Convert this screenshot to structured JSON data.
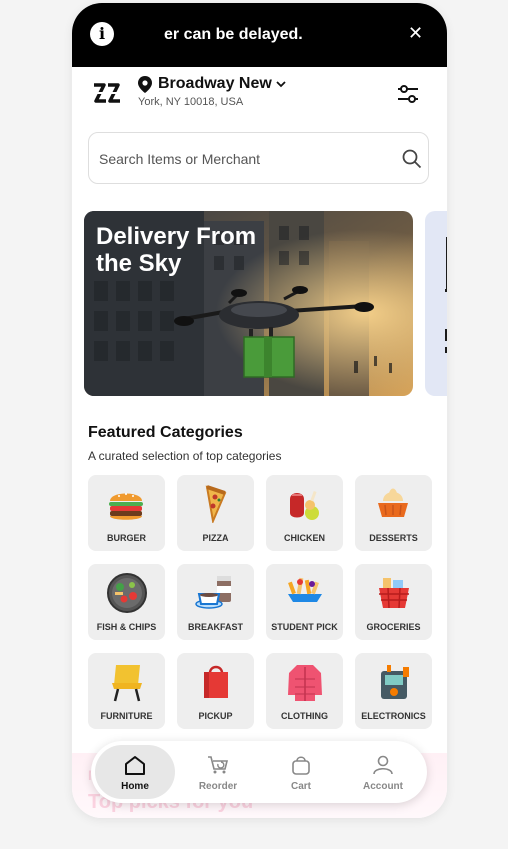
{
  "alert": {
    "text": "er can be delayed.",
    "info_icon": "info-icon",
    "close_icon": "close-icon"
  },
  "header": {
    "address_title": "Broadway New",
    "address_sub": "York, NY 10018, USA"
  },
  "search": {
    "placeholder": "Search Items or Merchant"
  },
  "banner": {
    "title": "Delivery From the Sky"
  },
  "featured": {
    "title": "Featured Categories",
    "subtitle": "A curated selection of top categories",
    "categories": [
      {
        "label": "BURGER",
        "icon": "burger-icon"
      },
      {
        "label": "PIZZA",
        "icon": "pizza-icon"
      },
      {
        "label": "CHICKEN",
        "icon": "chicken-icon"
      },
      {
        "label": "DESSERTS",
        "icon": "dessert-icon"
      },
      {
        "label": "FISH & CHIPS",
        "icon": "fish-chips-icon"
      },
      {
        "label": "BREAKFAST",
        "icon": "breakfast-icon"
      },
      {
        "label": "STUDENT PICK",
        "icon": "student-pick-icon"
      },
      {
        "label": "GROCERIES",
        "icon": "groceries-icon"
      },
      {
        "label": "FURNITURE",
        "icon": "furniture-icon"
      },
      {
        "label": "PICKUP",
        "icon": "pickup-bag-icon"
      },
      {
        "label": "CLOTHING",
        "icon": "jacket-icon"
      },
      {
        "label": "ELECTRONICS",
        "icon": "electronics-icon"
      }
    ]
  },
  "behind_nav": {
    "line1": "M",
    "line2": "Top picks for you"
  },
  "nav": {
    "home": "Home",
    "reorder": "Reorder",
    "cart": "Cart",
    "account": "Account"
  }
}
